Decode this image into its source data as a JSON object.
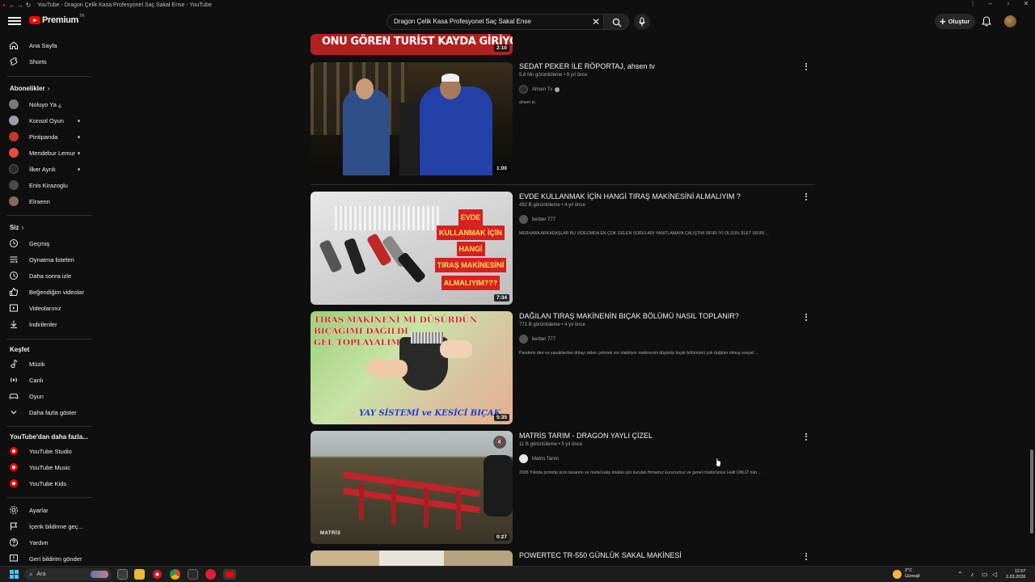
{
  "window": {
    "title": "YouTube - Dragon Çelik Kasa Profesyonel Saç Sakal Ense - YouTube"
  },
  "masthead": {
    "logo_text": "Premium",
    "logo_tr": "TR",
    "search_query": "Dragon Çelik Kasa Profesyonel Saç Sakal Ense",
    "create_label": "Oluştur"
  },
  "sidebar": {
    "main": [
      {
        "label": "Ana Sayfa",
        "icon": "home-icon"
      },
      {
        "label": "Shorts",
        "icon": "shorts-icon"
      }
    ],
    "subscriptions_heading": "Abonelikler",
    "subscriptions": [
      {
        "label": "Noluyo Ya ¿",
        "color": "#7a7a7a",
        "dot": false
      },
      {
        "label": "Konsol Oyun",
        "color": "#9aa0a6",
        "dot": true
      },
      {
        "label": "Pintipanda",
        "color": "#c0392b",
        "dot": true
      },
      {
        "label": "Mendebur Lemur",
        "color": "#e74c3c",
        "dot": true
      },
      {
        "label": "İlker Ayrık",
        "color": "#2c2c2c",
        "dot": true
      },
      {
        "label": "Enis Kirazoglu",
        "color": "#4a4a4a",
        "dot": false
      },
      {
        "label": "Elraenn",
        "color": "#8a6a5a",
        "dot": false
      }
    ],
    "you_heading": "Siz",
    "you": [
      {
        "label": "Geçmiş",
        "icon": "history-icon"
      },
      {
        "label": "Oynatma listeleri",
        "icon": "playlists-icon"
      },
      {
        "label": "Daha sonra izle",
        "icon": "watch-later-icon"
      },
      {
        "label": "Beğendiğim videolar",
        "icon": "liked-icon"
      },
      {
        "label": "Videolarınız",
        "icon": "your-videos-icon"
      },
      {
        "label": "İndirilenler",
        "icon": "download-icon"
      }
    ],
    "explore_heading": "Keşfet",
    "explore": [
      {
        "label": "Müzik",
        "icon": "music-icon"
      },
      {
        "label": "Canlı",
        "icon": "live-icon"
      },
      {
        "label": "Oyun",
        "icon": "gaming-icon"
      },
      {
        "label": "Daha fazla göster",
        "icon": "chevron-down-icon"
      }
    ],
    "more_heading": "YouTube'dan daha fazla...",
    "more": [
      {
        "label": "YouTube Studio"
      },
      {
        "label": "YouTube Music"
      },
      {
        "label": "YouTube Kids"
      }
    ],
    "settings": [
      {
        "label": "Ayarlar",
        "icon": "settings-icon"
      },
      {
        "label": "İçerik bildirme geç...",
        "icon": "flag-icon"
      },
      {
        "label": "Yardım",
        "icon": "help-icon"
      },
      {
        "label": "Geri bildirim gönder",
        "icon": "feedback-icon"
      }
    ]
  },
  "results": [
    {
      "title": "",
      "thumb_text": "ONU GÖREN TURİST KAYDA GİRİYOR!",
      "duration": "2:10"
    },
    {
      "title": "SEDAT PEKER İLE RÖPORTAJ, ahsen tv",
      "meta": "5,6 Mn görüntüleme • 9 yıl önce",
      "channel": "Ahsen Tv",
      "verified": true,
      "description": "ahsen tv.",
      "duration": "1:00"
    },
    {
      "title": "EVDE KULLANMAK İÇİN HANGİ TIRAŞ MAKİNESİNİ ALMALIYIM ?",
      "meta": "492 B görüntüleme • 4 yıl önce",
      "channel": "berber 777",
      "description": "MERHABA ARKADAŞLAR BU VİDEOMDA EN ÇOK GELEN SORULARI YANITLAMAYA ÇALIŞTIM SIFIRI İYİ OLSUN JİLET SIFIRI ...",
      "thumb_lines": [
        "EVDE",
        "KULLANMAK  İÇİN",
        "HANGİ",
        "TIRAŞ MAKİNESİNİ",
        "ALMALIYIM???"
      ],
      "duration": "7:34"
    },
    {
      "title": "DAĞILAN TIRAŞ MAKİNENİN BIÇAK BÖLÜMÜ NASIL TOPLANIR?",
      "meta": "771 B görüntüleme • 4 yıl önce",
      "channel": "berber 777",
      "description": "Pandemi den ve yasaklardan dolayı video çekmek zor olabiliyor makinesini düşürüp bıçak bölümünü çok dağıtan olmuş sosyal ...",
      "thumb_lines": [
        "TIRAŞ MAKİNENİ Mİ DÜŞÜRDÜN",
        "BIÇAĞIMI DAĞILDI",
        "GEL TOPLAYALIM"
      ],
      "thumb_bottom": "YAY SİSTEMİ ve KESİCİ BIÇAK",
      "duration": "5:35"
    },
    {
      "title": "MATRİS TARIM - DRAGON YAYLI ÇİZEL",
      "meta": "11 B görüntüleme • 5 yıl önce",
      "channel": "Matris Tarım",
      "description": "2005 Yılında prototip ürün tasarımı ve metal kalıp imalatı için kurulan firmamız kurucumuz ve genel müdürümüz Halit ÜNLÜ' nün ...",
      "thumb_logo": "MATRİS",
      "duration": "0:27"
    },
    {
      "title": "POWERTEC TR-550 GÜNLÜK SAKAL MAKİNESİ"
    }
  ],
  "taskbar": {
    "search_placeholder": "Ara",
    "weather_temp": "2°C",
    "weather_desc": "Güneşli",
    "time": "12:57",
    "date": "2.03.2026"
  },
  "colors": {
    "background": "#0f0f0f",
    "accent_red": "#ff0000",
    "text_primary": "#f1f1f1",
    "text_secondary": "#aaaaaa"
  }
}
